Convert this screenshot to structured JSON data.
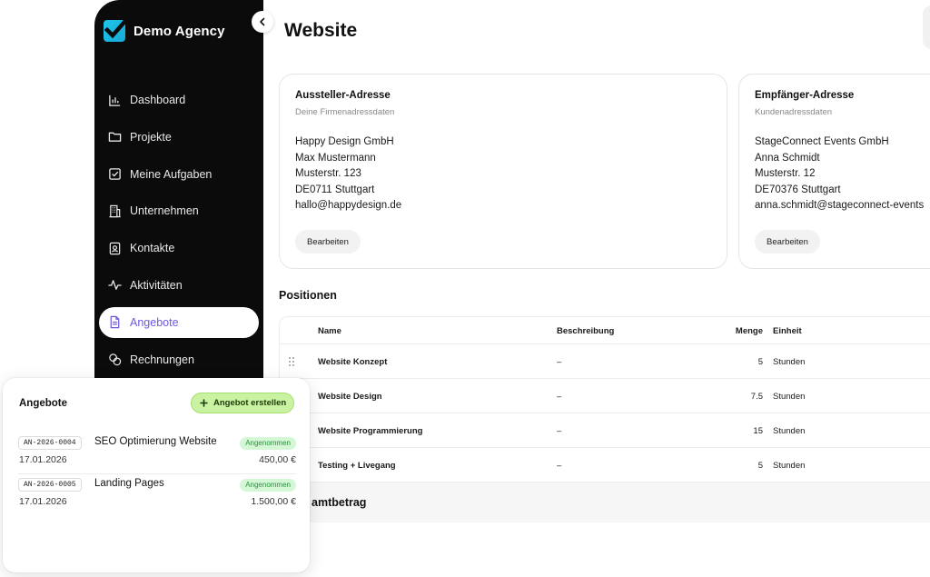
{
  "sidebar": {
    "brand_name": "Demo Agency",
    "collapse_icon": "chevron-left-icon",
    "items": [
      {
        "label": "Dashboard",
        "icon": "bar-chart-icon",
        "active": false
      },
      {
        "label": "Projekte",
        "icon": "folder-icon",
        "active": false
      },
      {
        "label": "Meine Aufgaben",
        "icon": "checkbox-icon",
        "active": false
      },
      {
        "label": "Unternehmen",
        "icon": "building-icon",
        "active": false
      },
      {
        "label": "Kontakte",
        "icon": "contact-card-icon",
        "active": false
      },
      {
        "label": "Aktivitäten",
        "icon": "activity-icon",
        "active": false
      },
      {
        "label": "Angebote",
        "icon": "document-icon",
        "active": true
      },
      {
        "label": "Rechnungen",
        "icon": "coins-icon",
        "active": false
      }
    ],
    "active_color": "#6f58d8"
  },
  "main": {
    "title": "Website",
    "sender": {
      "title": "Aussteller-Adresse",
      "subtitle": "Deine Firmenadressdaten",
      "lines": [
        "Happy Design GmbH",
        "Max Mustermann",
        "Musterstr. 123",
        "DE0711 Stuttgart",
        "hallo@happydesign.de"
      ],
      "edit_label": "Bearbeiten"
    },
    "receiver": {
      "title": "Empfänger-Adresse",
      "subtitle": "Kundenadressdaten",
      "lines": [
        "StageConnect Events GmbH",
        "Anna Schmidt",
        "Musterstr. 12",
        "DE70376 Stuttgart",
        "anna.schmidt@stageconnect-events"
      ],
      "edit_label": "Bearbeiten"
    },
    "positions": {
      "label": "Positionen",
      "headers": {
        "name": "Name",
        "description": "Beschreibung",
        "quantity": "Menge",
        "unit": "Einheit"
      },
      "rows": [
        {
          "name": "Website Konzept",
          "description": "–",
          "quantity": "5",
          "unit": "Stunden"
        },
        {
          "name": "Website Design",
          "description": "–",
          "quantity": "7.5",
          "unit": "Stunden"
        },
        {
          "name": "Website Programmierung",
          "description": "–",
          "quantity": "15",
          "unit": "Stunden"
        },
        {
          "name": "Testing + Livegang",
          "description": "–",
          "quantity": "5",
          "unit": "Stunden"
        }
      ],
      "total_label": "amtbetrag"
    }
  },
  "offers_card": {
    "title": "Angebote",
    "create_label": "Angebot erstellen",
    "accent_color": "#c9f3a2",
    "items": [
      {
        "id": "AN-2026-0004",
        "name": "SEO Optimierung Website",
        "status": "Angenommen",
        "date": "17.01.2026",
        "amount": "450,00 €"
      },
      {
        "id": "AN-2026-0005",
        "name": "Landing Pages",
        "status": "Angenommen",
        "date": "17.01.2026",
        "amount": "1.500,00 €"
      }
    ]
  }
}
